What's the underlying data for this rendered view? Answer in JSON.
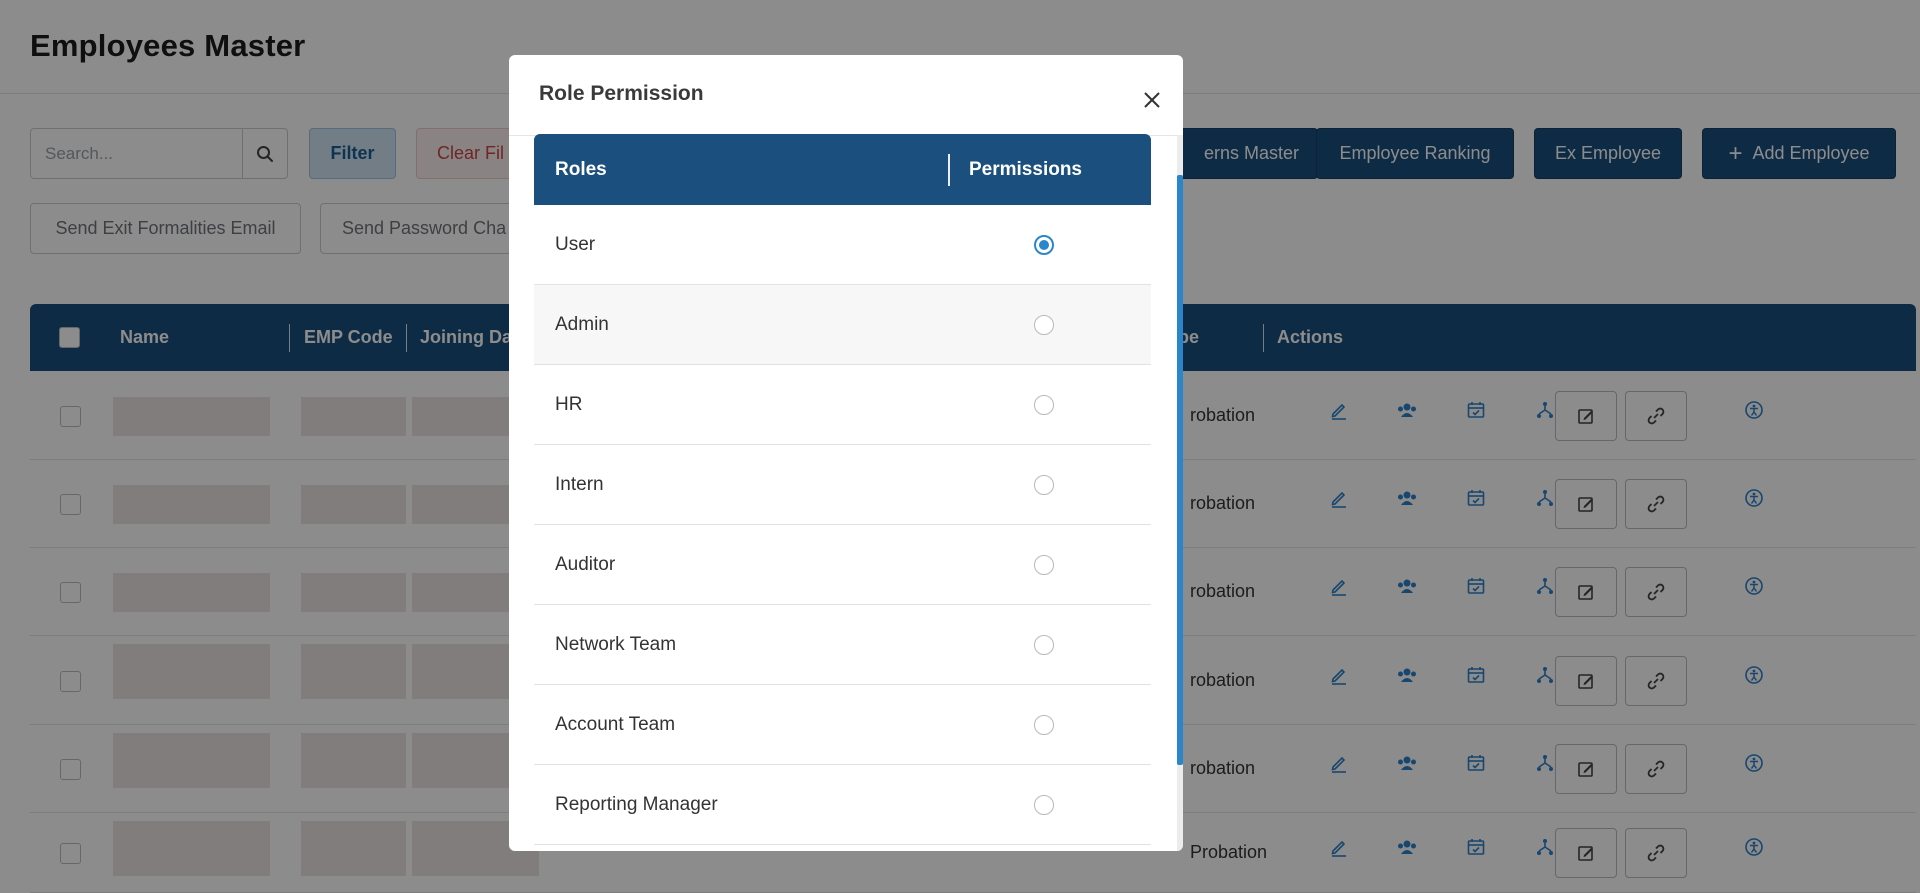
{
  "page": {
    "title": "Employees Master",
    "search": {
      "placeholder": "Search..."
    },
    "toolbar": {
      "filter_label": "Filter",
      "clear_filter_label": "Clear Fil",
      "interns_master_label": "erns Master",
      "employee_ranking_label": "Employee Ranking",
      "ex_employee_label": "Ex Employee",
      "add_employee_label": "Add Employee",
      "send_exit_email_label": "Send Exit Formalities Email",
      "send_password_label": "Send Password Cha"
    },
    "table": {
      "columns": {
        "name": "Name",
        "emp_code": "EMP Code",
        "joining_date": "Joining Dat",
        "type": "pe",
        "actions": "Actions"
      },
      "rows": [
        {
          "status": "robation"
        },
        {
          "status": "robation"
        },
        {
          "status": "robation"
        },
        {
          "status": "robation"
        },
        {
          "status": "robation"
        },
        {
          "status": "Probation"
        }
      ]
    }
  },
  "modal": {
    "title": "Role Permission",
    "columns": {
      "roles": "Roles",
      "permissions": "Permissions"
    },
    "roles": [
      {
        "label": "User",
        "selected": true
      },
      {
        "label": "Admin",
        "selected": false
      },
      {
        "label": "HR",
        "selected": false
      },
      {
        "label": "Intern",
        "selected": false
      },
      {
        "label": "Auditor",
        "selected": false
      },
      {
        "label": "Network Team",
        "selected": false
      },
      {
        "label": "Account Team",
        "selected": false
      },
      {
        "label": "Reporting Manager",
        "selected": false
      }
    ]
  },
  "colors": {
    "navy": "#1a4f7e",
    "accent": "#2a86c9",
    "danger": "#c94545",
    "placeholder": "#ede3e3"
  },
  "icons": [
    "search-icon",
    "plus-icon",
    "close-icon",
    "edit-pencil-icon",
    "group-icon",
    "calendar-icon",
    "hierarchy-icon",
    "edit-box-icon",
    "link-icon",
    "accessibility-icon"
  ]
}
